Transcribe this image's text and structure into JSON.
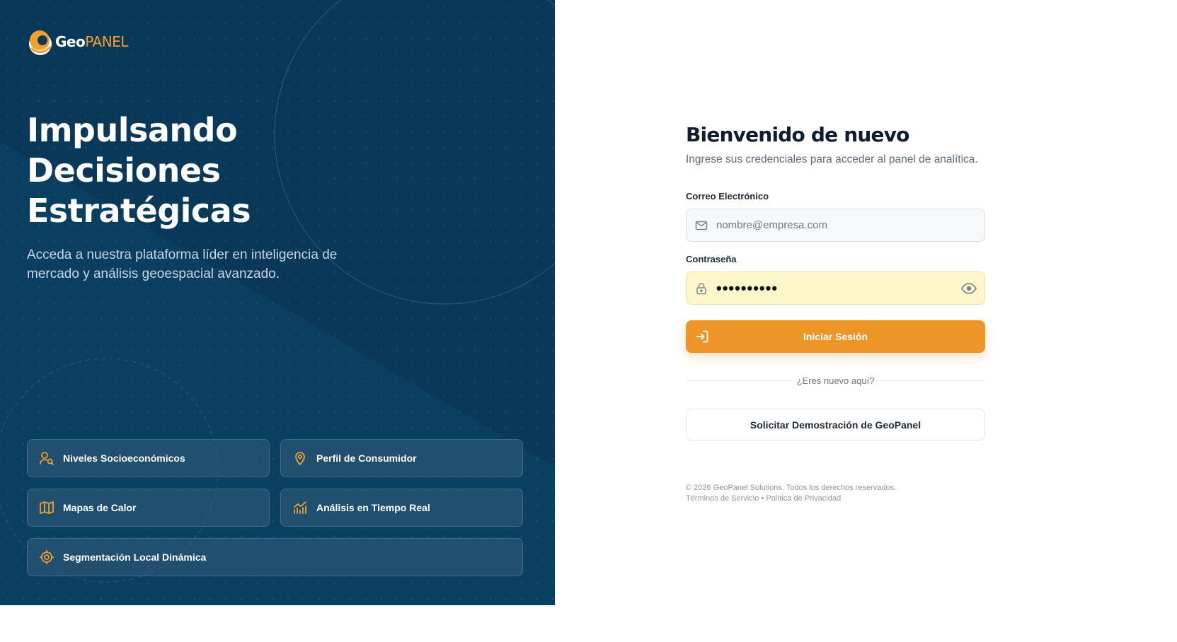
{
  "brand": {
    "logo_geo": "Geo",
    "logo_panel": "PANEL"
  },
  "hero": {
    "title_lines": [
      "Impulsando",
      "Decisiones",
      "Estratégicas"
    ],
    "subtitle_lines": [
      "Acceda a nuestra plataforma líder en inteligencia de",
      "mercado y análisis geoespacial avanzado."
    ],
    "features": [
      {
        "label": "Niveles Socioeconómicos",
        "icon": "user-search-icon"
      },
      {
        "label": "Perfil de Consumidor",
        "icon": "map-pin-icon"
      },
      {
        "label": "Mapas de Calor",
        "icon": "map-icon"
      },
      {
        "label": "Análisis en Tiempo Real",
        "icon": "chart-trend-icon"
      },
      {
        "label": "Segmentación Local Dinámica",
        "icon": "target-icon"
      }
    ]
  },
  "login": {
    "title": "Bienvenido de nuevo",
    "subtitle": "Ingrese sus credenciales para acceder al panel de analítica.",
    "email_label": "Correo Electrónico",
    "email_placeholder": "nombre@empresa.com",
    "password_label": "Contraseña",
    "password_value": "••••••••••",
    "submit_label": "Iniciar Sesión",
    "divider_text": "¿Eres nuevo aquí?",
    "demo_label": "Solicitar Demostración de GeoPanel"
  },
  "footer": {
    "copyright": "© 2026 GeoPanel Solutions. Todos los derechos reservados.",
    "terms": "Términos de Servicio",
    "separator": "•",
    "privacy": "Política de Privacidad"
  },
  "colors": {
    "hero_bg": "#0b3a5c",
    "accent": "#ee9528",
    "password_fill": "#fdf7c9"
  }
}
